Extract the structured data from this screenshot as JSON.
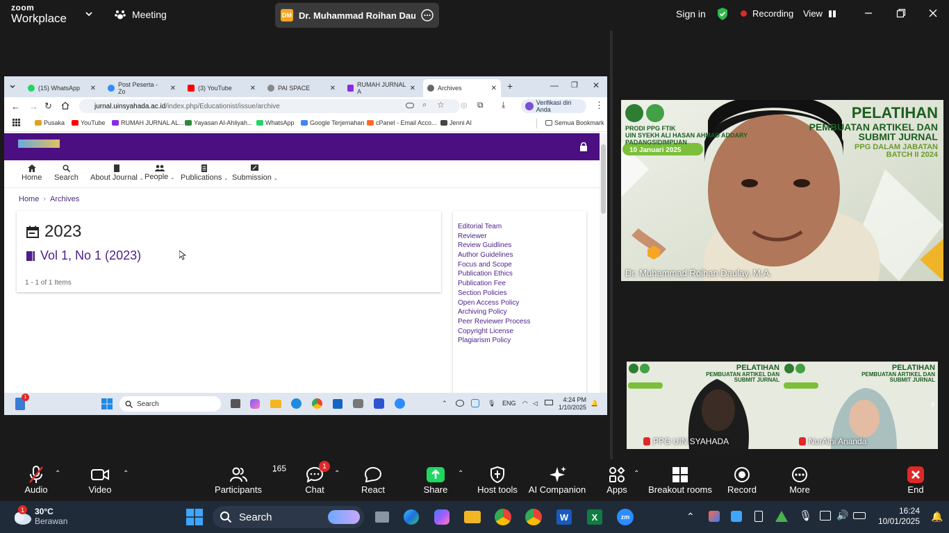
{
  "zoom_top": {
    "logo_line1": "zoom",
    "logo_line2": "Workplace",
    "meeting_label": "Meeting",
    "host_initials": "DM",
    "host_pill": "Dr. Muhammad Roihan Daulay, I",
    "sign_in": "Sign in",
    "recording": "Recording",
    "view": "View"
  },
  "browser": {
    "tabs": [
      {
        "label": "(15) WhatsApp",
        "color": "#25d366"
      },
      {
        "label": "Post Peserta - Zo",
        "color": "#2d8cff"
      },
      {
        "label": "(3) YouTube",
        "color": "#ff0000"
      },
      {
        "label": "PAI SPACE",
        "color": "#888888"
      },
      {
        "label": "RUMAH JURNAL A",
        "color": "#8a2be2"
      },
      {
        "label": "Archives",
        "color": "#666666"
      }
    ],
    "url_domain": "jurnal.uinsyahada.ac.id",
    "url_path": "/index.php/Educationist/issue/archive",
    "verify_label": "Verifikasi diri Anda",
    "bookmarks": [
      {
        "label": "Pusaka",
        "color": "#e0a020"
      },
      {
        "label": "YouTube",
        "color": "#ff0000"
      },
      {
        "label": "RUMAH JURNAL AL...",
        "color": "#8a2be2"
      },
      {
        "label": "Yayasan Al-Ahliyah...",
        "color": "#2a8a3a"
      },
      {
        "label": "WhatsApp",
        "color": "#25d366"
      },
      {
        "label": "Google Terjemahan",
        "color": "#4285f4"
      },
      {
        "label": "cPanel - Email Acco...",
        "color": "#ff6c2c"
      },
      {
        "label": "Jenni AI",
        "color": "#444444"
      }
    ],
    "all_bookmarks": "Semua Bookmark"
  },
  "ojs": {
    "nav": [
      {
        "label": "Home",
        "dropdown": false
      },
      {
        "label": "Search",
        "dropdown": false
      },
      {
        "label": "About Journal",
        "dropdown": true
      },
      {
        "label": "People",
        "dropdown": true
      },
      {
        "label": "Publications",
        "dropdown": true
      },
      {
        "label": "Submission",
        "dropdown": true
      }
    ],
    "breadcrumb_home": "Home",
    "breadcrumb_current": "Archives",
    "year": "2023",
    "issue": "Vol 1, No 1 (2023)",
    "count": "1 - 1 of 1 Items",
    "sidebar_links": [
      "Editorial Team",
      "Reviewer",
      "Review Guidlines",
      "Author Guidelines",
      "Focus and Scope",
      "Publication Ethics",
      "Publication Fee",
      "Section Policies",
      "Open Access Policy",
      "Archiving Policy",
      "Peer Reviewer Process",
      "Copyright License",
      "Plagiarism Policy"
    ]
  },
  "inner_taskbar": {
    "search": "Search",
    "lang": "ENG",
    "time": "4:24 PM",
    "date": "1/10/2025",
    "notif_count": "1"
  },
  "videos": {
    "main_name": "Dr. Muhammad Roihan Daulay, M.A.",
    "banner_title": "PELATIHAN",
    "banner_sub1": "PEMBUATAN ARTIKEL DAN",
    "banner_sub2": "SUBMIT JURNAL",
    "banner_sub3": "PPG DALAM JABATAN",
    "banner_sub4": "BATCH II 2024",
    "banner_org1": "PRODI PPG FTIK",
    "banner_org2": "UIN SYEKH ALI HASAN AHMAD ADDARY",
    "banner_org3": "PADANGSIDIMPUAN",
    "banner_date": "10 Januari 2025",
    "small": [
      {
        "name": "PPG UIN SYAHADA"
      },
      {
        "name": "NurAini Ananda"
      }
    ]
  },
  "controls": {
    "audio": "Audio",
    "video": "Video",
    "participants": "Participants",
    "participants_count": "165",
    "chat": "Chat",
    "chat_badge": "1",
    "react": "React",
    "share": "Share",
    "host_tools": "Host tools",
    "ai_companion": "AI Companion",
    "apps": "Apps",
    "breakout": "Breakout rooms",
    "record": "Record",
    "more": "More",
    "end": "End"
  },
  "taskbar": {
    "temp": "30°C",
    "weather": "Berawan",
    "search": "Search",
    "time": "16:24",
    "date": "10/01/2025",
    "weather_badge": "1"
  }
}
